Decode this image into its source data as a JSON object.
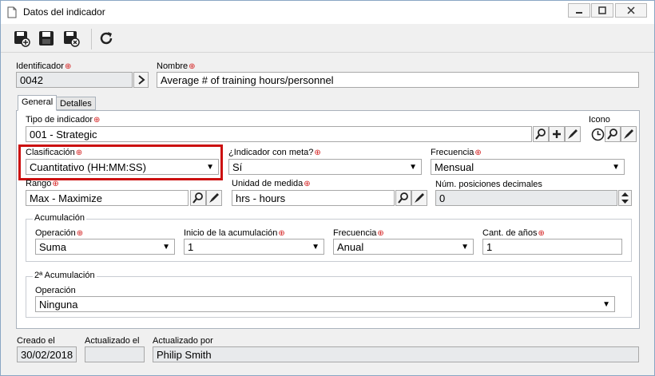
{
  "window": {
    "title": "Datos del indicador"
  },
  "toolbar": {
    "save_new": "save-new",
    "save": "save",
    "save_close": "save-close",
    "refresh": "refresh"
  },
  "fields": {
    "identificador_label": "Identificador",
    "identificador_value": "0042",
    "nombre_label": "Nombre",
    "nombre_value": "Average # of training hours/personnel"
  },
  "tabs": [
    {
      "label": "General"
    },
    {
      "label": "Detalles"
    }
  ],
  "general": {
    "tipo_label": "Tipo de indicador",
    "tipo_value": "001 - Strategic",
    "icono_label": "Icono",
    "clasificacion_label": "Clasificación",
    "clasificacion_value": "Cuantitativo (HH:MM:SS)",
    "meta_label": "¿Indicador con meta?",
    "meta_value": "Sí",
    "frecuencia_label": "Frecuencia",
    "frecuencia_value": "Mensual",
    "rango_label": "Rango",
    "rango_value": "Max - Maximize",
    "unidad_label": "Unidad de medida",
    "unidad_value": "hrs - hours",
    "decimales_label": "Núm. posiciones decimales",
    "decimales_value": "0"
  },
  "acumulacion": {
    "title": "Acumulación",
    "operacion_label": "Operación",
    "operacion_value": "Suma",
    "inicio_label": "Inicio de la acumulación",
    "inicio_value": "1",
    "frecuencia_label": "Frecuencia",
    "frecuencia_value": "Anual",
    "anos_label": "Cant. de años",
    "anos_value": "1"
  },
  "acumulacion2": {
    "title": "2ª Acumulación",
    "operacion_label": "Operación",
    "operacion_value": "Ninguna"
  },
  "footer": {
    "creado_label": "Creado el",
    "creado_value": "30/02/2018",
    "actualizado_label": "Actualizado el",
    "actualizado_value": "",
    "actualizado_por_label": "Actualizado por",
    "actualizado_por_value": "Philip Smith"
  },
  "colors": {
    "required": "#d42020",
    "highlight": "#cc1010"
  }
}
